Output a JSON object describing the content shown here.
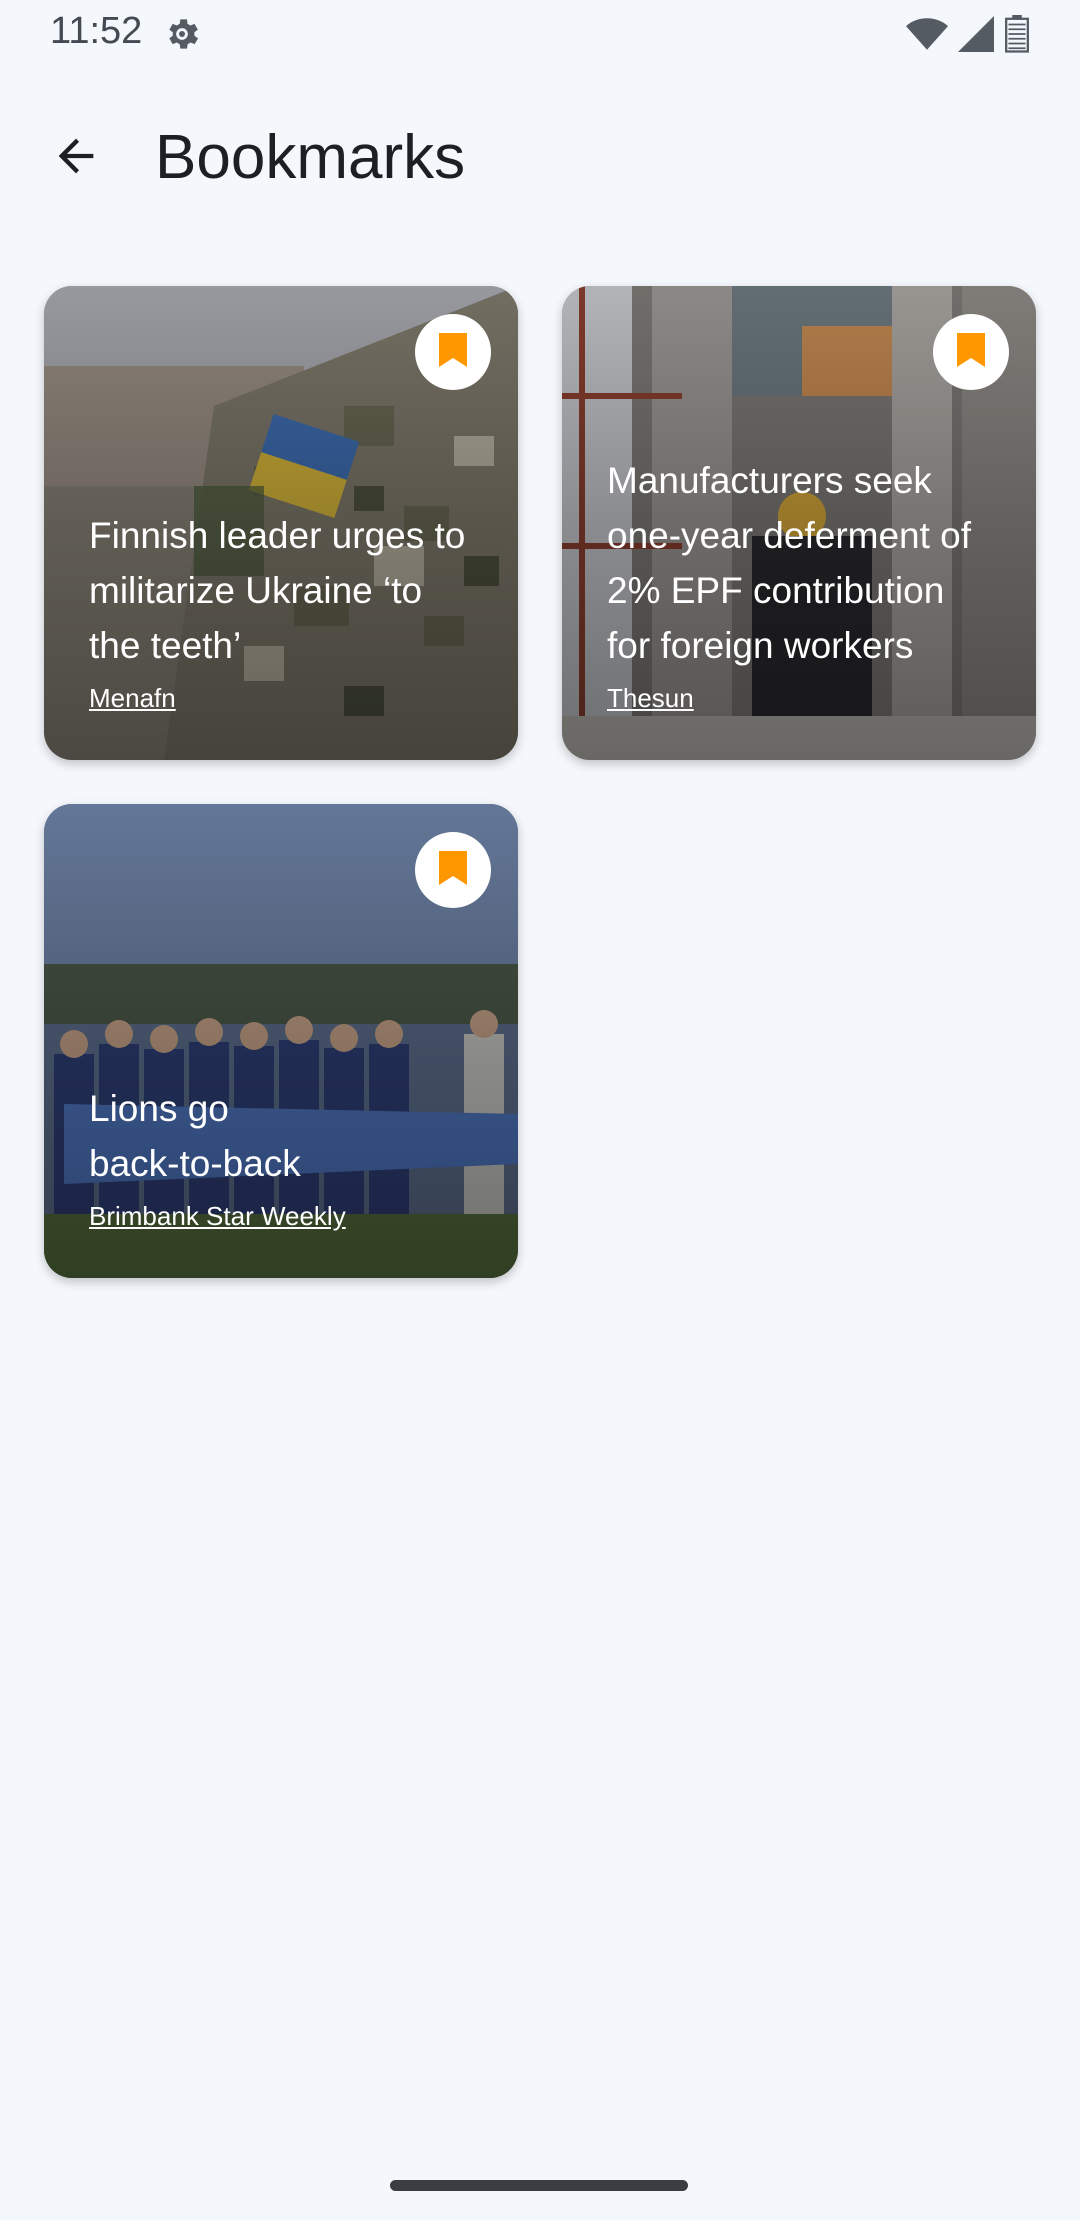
{
  "status_bar": {
    "time": "11:52",
    "icons": [
      "settings-gear-icon",
      "wifi-icon",
      "signal-icon",
      "battery-icon"
    ]
  },
  "app_bar": {
    "back_icon": "arrow-back-icon",
    "title": "Bookmarks"
  },
  "colors": {
    "background": "#f4f7fc",
    "bookmark_accent": "#ff9800",
    "title_text": "#1c1f24"
  },
  "bookmarks": [
    {
      "title": "Finnish leader urges to militarize Ukraine ‘to the teeth’",
      "source": "Menafn",
      "image": "soldier-camouflage-ukraine-patch",
      "bookmark_icon": "bookmark-filled-icon"
    },
    {
      "title": "Manufacturers seek one-year deferment of 2% EPF contribution for foreign workers",
      "source": "Thesun",
      "image": "construction-worker-hard-hat",
      "bookmark_icon": "bookmark-filled-icon"
    },
    {
      "title": "Lions go back-to-back",
      "source": "Brimbank Star Weekly",
      "image": "team-photo-with-banner",
      "bookmark_icon": "bookmark-filled-icon"
    }
  ]
}
